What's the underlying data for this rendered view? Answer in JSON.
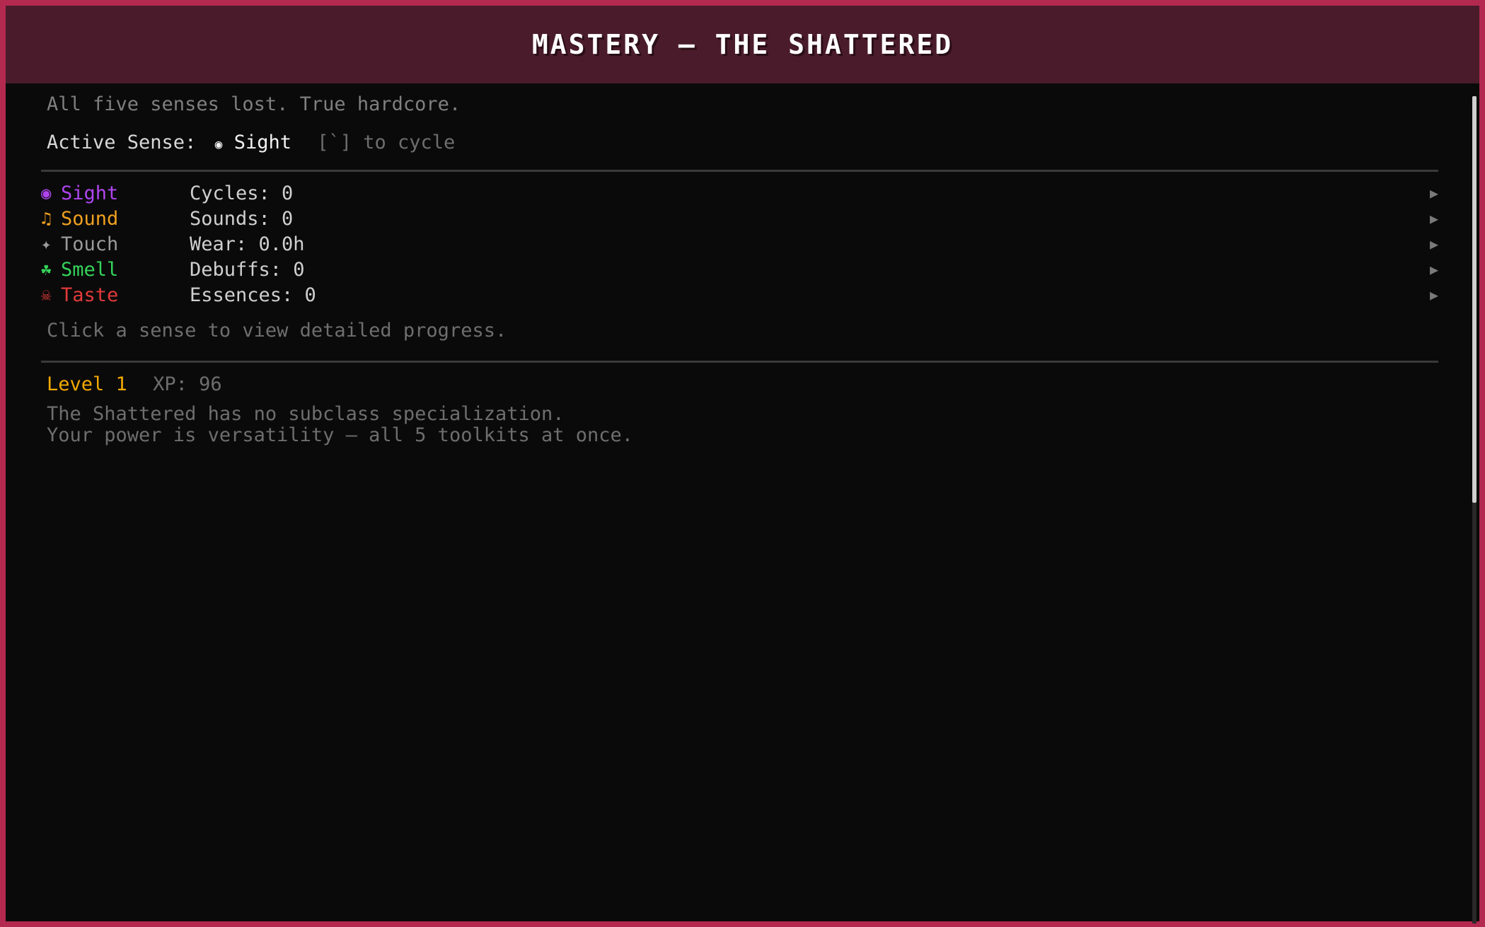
{
  "window": {
    "title": "MASTERY — THE SHATTERED"
  },
  "intro": {
    "description": "All five senses lost. True hardcore.",
    "active_label": "Active Sense:",
    "active_icon": "◉",
    "active_value": "Sight",
    "cycle_hint": "[`] to cycle"
  },
  "senses": [
    {
      "icon": "eye-icon",
      "glyph": "◉",
      "name": "Sight",
      "stat": "Cycles: 0",
      "color": "#b045f0"
    },
    {
      "icon": "music-note-icon",
      "glyph": "♫",
      "name": "Sound",
      "stat": "Sounds: 0",
      "color": "#f0a020"
    },
    {
      "icon": "hand-icon",
      "glyph": "✦",
      "name": "Touch",
      "stat": "Wear: 0.0h",
      "color": "#9a9a9a"
    },
    {
      "icon": "nose-icon",
      "glyph": "☘",
      "name": "Smell",
      "stat": "Debuffs: 0",
      "color": "#35d45a"
    },
    {
      "icon": "skull-icon",
      "glyph": "☠",
      "name": "Taste",
      "stat": "Essences: 0",
      "color": "#e23a3a"
    }
  ],
  "senses_hint": "Click a sense to view detailed progress.",
  "arrow_glyph": "▶",
  "progress": {
    "level": "Level 1",
    "xp": "XP: 96",
    "note_1": "The Shattered has no subclass specialization.",
    "note_2": "Your power is versatility — all 5 toolkits at once."
  }
}
